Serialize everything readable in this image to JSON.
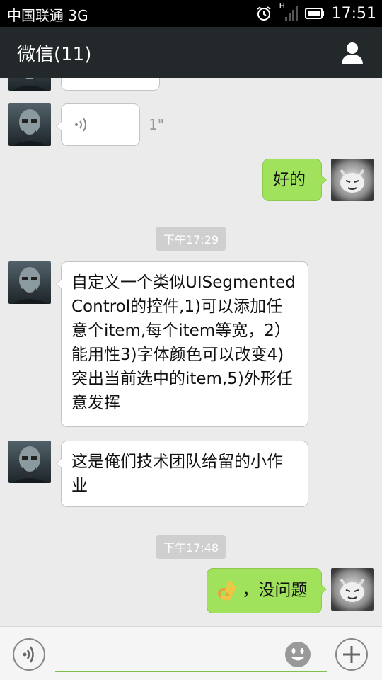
{
  "status_bar": {
    "carrier": "中国联通 3G",
    "network_label": "H",
    "time": "17:51"
  },
  "header": {
    "title": "微信(11)",
    "contact_icon": "person-icon"
  },
  "messages": {
    "voice": {
      "duration": "1\""
    },
    "reply_ok": {
      "text": "好的"
    },
    "timestamp_1": "下午17:29",
    "task": {
      "text": "自定义一个类似UISegmentedControl的控件,1)可以添加任意个item,每个item等宽，2）能用性3)字体颜色可以改变4)突出当前选中的item,5)外形任意发挥"
    },
    "note": {
      "text": "这是俺们技术团队给留的小作业"
    },
    "timestamp_2": "下午17:48",
    "reply_no_problem": {
      "text": "，没问题",
      "emoji": "ok-hand-emoji"
    }
  },
  "input_bar": {
    "voice_icon": "voice-icon",
    "emoji_icon": "smiley-icon",
    "plus_icon": "plus-icon",
    "placeholder": ""
  },
  "colors": {
    "header_bg": "#23292b",
    "chat_bg": "#ebebeb",
    "sent_bubble": "#a0e25c",
    "input_underline": "#7cc24b"
  }
}
